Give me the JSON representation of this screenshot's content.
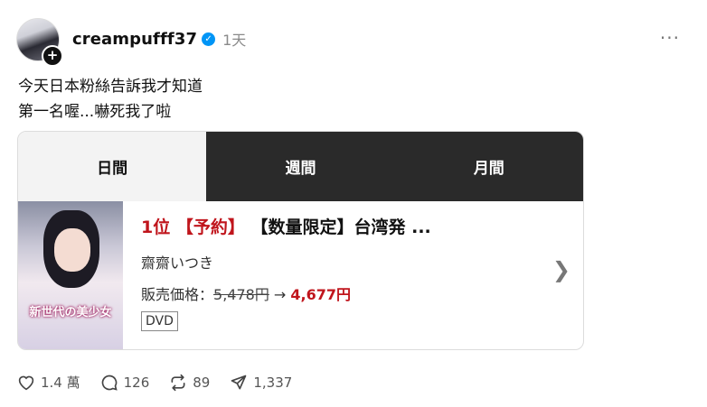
{
  "post": {
    "username": "creampufff37",
    "time": "1天",
    "more": "···",
    "text_line1": "今天日本粉絲告訴我才知道",
    "text_line2": "第一名喔...嚇死我了啦"
  },
  "card": {
    "tabs": [
      {
        "label": "日間",
        "active": true
      },
      {
        "label": "週間",
        "active": false
      },
      {
        "label": "月間",
        "active": false
      }
    ],
    "item": {
      "rank": "1位",
      "preorder": "【予約】",
      "title": "【数量限定】台湾発 ...",
      "author": "齋齋いつき",
      "price_label": "販売価格：",
      "old_price": "5,478円",
      "arrow": " → ",
      "new_price": "4,677円",
      "format": "DVD",
      "cover_text": "新世代の美少女"
    }
  },
  "actions": {
    "likes": "1.4 萬",
    "comments": "126",
    "reposts": "89",
    "shares": "1,337"
  }
}
